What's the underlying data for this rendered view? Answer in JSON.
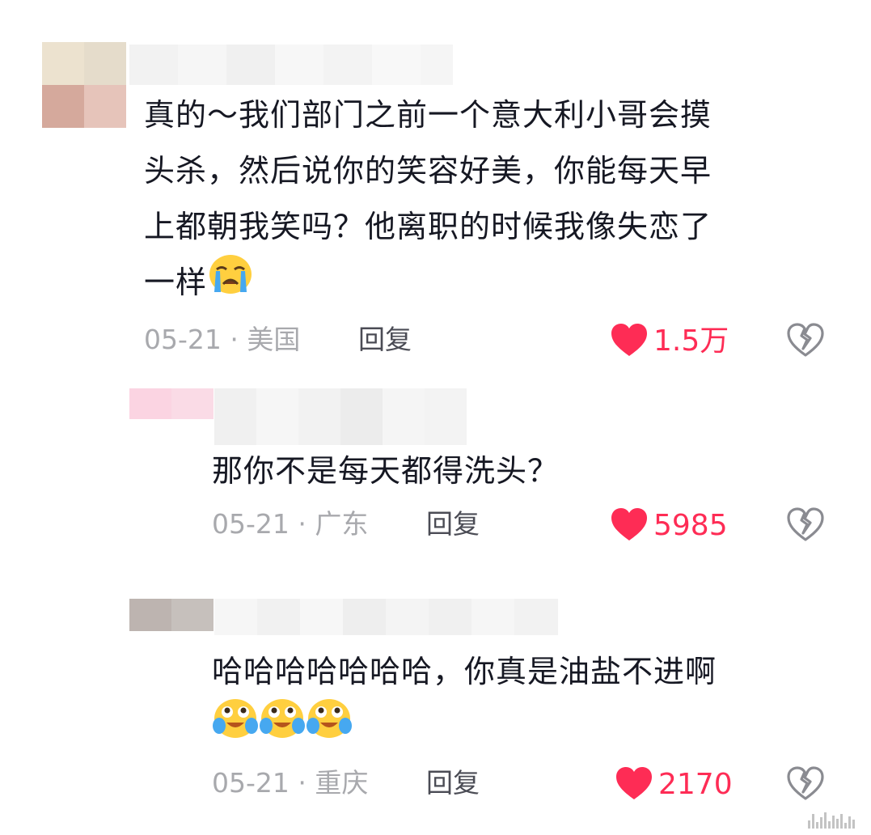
{
  "colors": {
    "like": "#fe2c55",
    "meta": "#a8a9ad",
    "reply": "#4b4c55",
    "text": "#161823"
  },
  "comments": [
    {
      "text_lines": [
        "真的～我们部门之前一个意大利小哥会摸",
        "头杀，然后说你的笑容好美，你能每天早",
        "上都朝我笑吗？他离职的时候我像失恋了",
        "一样"
      ],
      "emoji": "loudly-crying-icon",
      "date": "05-21",
      "location": "美国",
      "reply": "回复",
      "likes": "1.5万"
    },
    {
      "text": "那你不是每天都得洗头？",
      "date": "05-21",
      "location": "广东",
      "reply": "回复",
      "likes": "5985"
    },
    {
      "text": "哈哈哈哈哈哈哈，你真是油盐不进啊",
      "emojis": [
        "teary-laugh-icon",
        "teary-laugh-icon",
        "teary-laugh-icon"
      ],
      "date": "05-21",
      "location": "重庆",
      "reply": "回复",
      "likes": "2170"
    }
  ]
}
